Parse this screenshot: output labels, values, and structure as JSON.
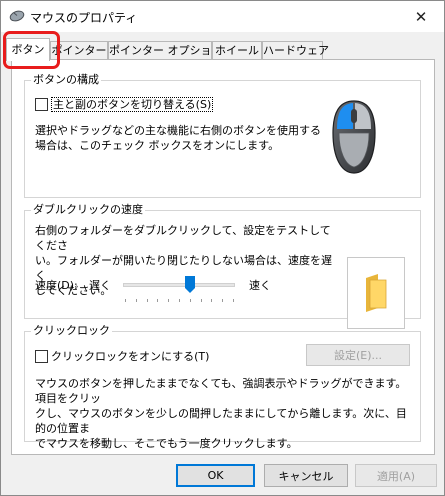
{
  "window": {
    "title": "マウスのプロパティ",
    "close_glyph": "✕"
  },
  "tabs": [
    {
      "label": "ボタン",
      "active": true
    },
    {
      "label": "ポインター"
    },
    {
      "label": "ポインター オプション"
    },
    {
      "label": "ホイール"
    },
    {
      "label": "ハードウェア"
    }
  ],
  "highlight_color": "#e81c1c",
  "button_config": {
    "legend": "ボタンの構成",
    "swap_label": "主と副のボタンを切り替える(S)",
    "swap_checked": false,
    "description": "選択やドラッグなどの主な機能に右側のボタンを使用する\n場合は、このチェック ボックスをオンにします。"
  },
  "double_click": {
    "legend": "ダブルクリックの速度",
    "description": "右側のフォルダーをダブルクリックして、設定をテストしてくださ\nい。フォルダーが開いたり閉じたりしない場合は、速度を遅く\nしてください。",
    "speed_label": "速度(D):",
    "slow_label": "遅く",
    "fast_label": "速く",
    "speed_value": 0.6
  },
  "click_lock": {
    "legend": "クリックロック",
    "checkbox_label": "クリックロックをオンにする(T)",
    "checked": false,
    "settings_button": "設定(E)...",
    "description": "マウスのボタンを押したままでなくても、強調表示やドラッグができます。項目をクリッ\nクし、マウスのボタンを少しの間押したままにしてから離します。次に、目的の位置ま\nでマウスを移動し、そこでもう一度クリックします。"
  },
  "footer": {
    "ok": "OK",
    "cancel": "キャンセル",
    "apply": "適用(A)"
  },
  "accent_color": "#0078d7"
}
